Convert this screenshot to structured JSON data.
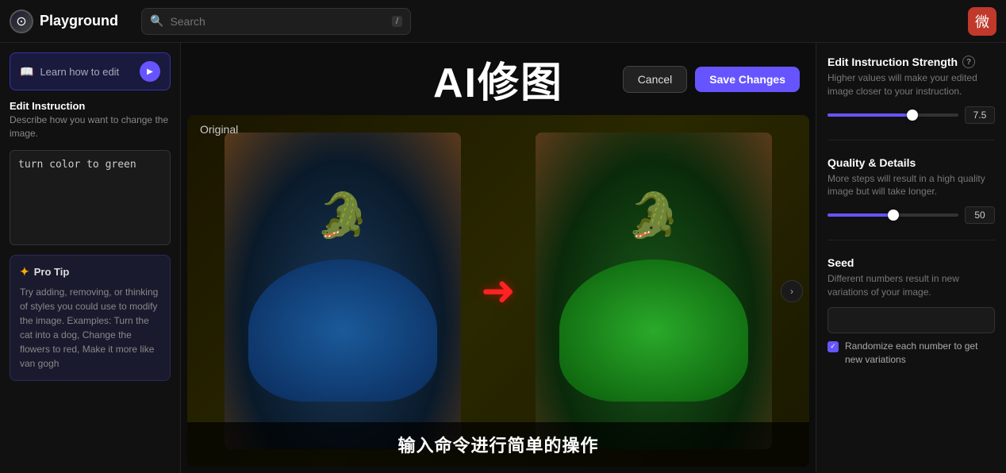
{
  "topbar": {
    "logo_icon": "⊙",
    "logo_text": "Playground",
    "search_placeholder": "Search",
    "shortcut": "/",
    "avatar_emoji": "微"
  },
  "left_sidebar": {
    "learn_btn_label": "Learn how to edit",
    "edit_instruction_title": "Edit Instruction",
    "edit_instruction_desc": "Describe how you want to change the image.",
    "instruction_value": "turn color to green",
    "pro_tip_title": "Pro Tip",
    "pro_tip_text": "Try adding, removing, or thinking of styles you could use to modify the image. Examples: Turn the cat into a dog, Change the flowers to red, Make it more like van gogh"
  },
  "center": {
    "title": "AI修图",
    "cancel_label": "Cancel",
    "save_label": "Save Changes",
    "original_label": "Original",
    "subtitle": "输入命令进行简单的操作"
  },
  "right_sidebar": {
    "strength_title": "Edit Instruction Strength",
    "strength_desc": "Higher values will make your edited image closer to your instruction.",
    "strength_value": "7.5",
    "strength_pct": 65,
    "quality_title": "Quality & Details",
    "quality_desc": "More steps will result in a high quality image but will take longer.",
    "quality_value": "50",
    "quality_pct": 50,
    "seed_title": "Seed",
    "seed_desc": "Different numbers result in new variations of your image.",
    "seed_value": "",
    "randomize_label": "Randomize each number to get new variations"
  }
}
